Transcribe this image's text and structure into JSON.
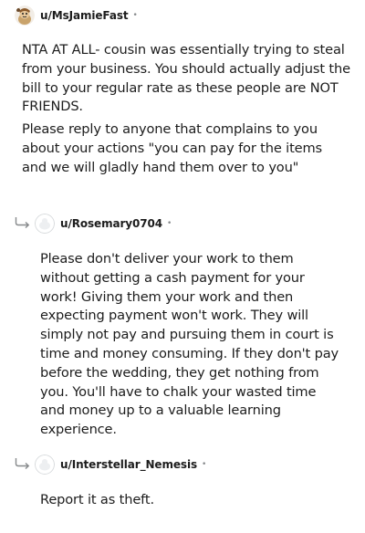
{
  "comments": [
    {
      "username": "u/MsJamieFast",
      "separator": "•",
      "paragraphs": [
        "NTA AT ALL- cousin was essentially trying to steal from your business. You should actually adjust the bill to your regular rate as these people are NOT FRIENDS.",
        "Please reply to anyone that complains to you about your actions \"you can pay for the items and we will gladly hand them over to you\""
      ]
    },
    {
      "username": "u/Rosemary0704",
      "separator": "•",
      "paragraphs": [
        "Please don't deliver your work to them without getting a cash payment for your work! Giving them your work and then expecting payment won't work. They will simply not pay and pursuing them in court is time and money consuming. If they don't pay before the wedding, they get nothing from you. You'll have to chalk your wasted time and money up to a valuable learning experience."
      ]
    },
    {
      "username": "u/Interstellar_Nemesis",
      "separator": "•",
      "paragraphs": [
        "Report it as theft."
      ]
    }
  ],
  "icons": {
    "custom_avatar": "snoo-avatar-icon",
    "default_avatar": "default-avatar-icon",
    "reply_arrow": "reply-arrow-icon"
  },
  "colors": {
    "text": "#1c1c1c",
    "meta": "#878a8c",
    "default_avatar": "#d7dadc"
  }
}
